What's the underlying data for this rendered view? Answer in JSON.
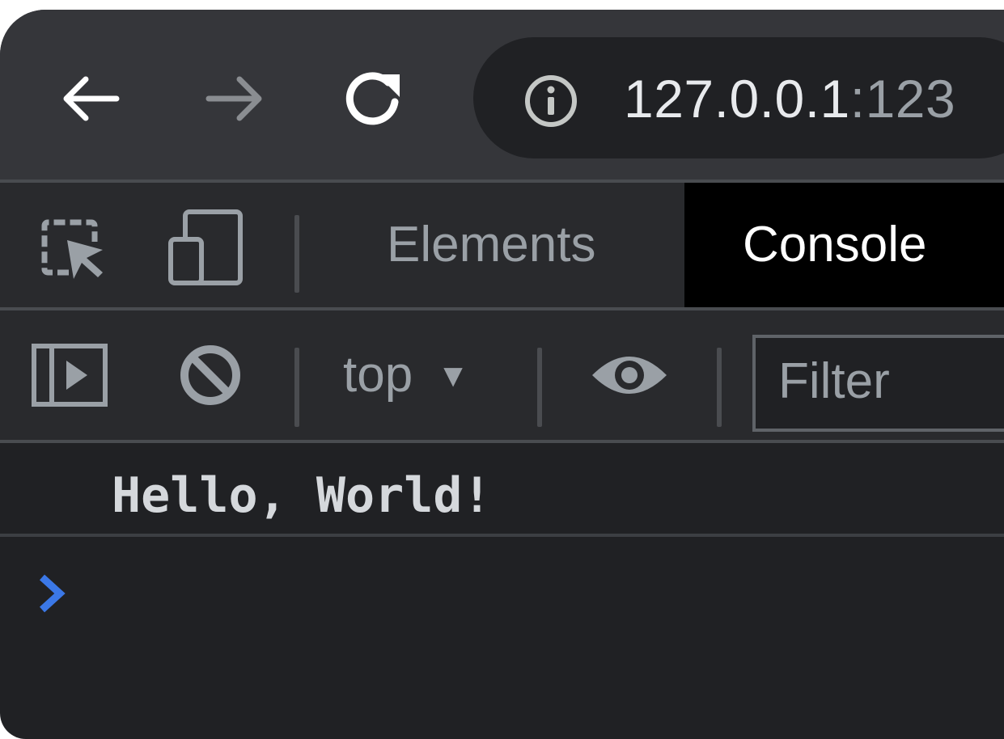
{
  "browser": {
    "url_host": "127.0.0.1",
    "url_port": ":123",
    "icons": {
      "back": "arrow-left",
      "forward": "arrow-right",
      "reload": "reload",
      "site_info": "info-circle"
    }
  },
  "devtools": {
    "tabs": [
      {
        "label": "Elements",
        "active": false
      },
      {
        "label": "Console",
        "active": true
      }
    ],
    "icons": {
      "inspect": "inspect-element",
      "device": "device-toggle"
    }
  },
  "console_toolbar": {
    "context": "top",
    "filter_placeholder": "Filter",
    "icons": {
      "sidebar": "sidebar-toggle",
      "clear": "clear-console",
      "live_expression": "eye"
    }
  },
  "console": {
    "messages": [
      {
        "text": "Hello, World!"
      }
    ],
    "prompt_color": "#3b78e7"
  },
  "colors": {
    "toolbar_bg": "#35363a",
    "panel_bg": "#292a2d",
    "console_bg": "#202124",
    "active_tab_bg": "#000000"
  }
}
